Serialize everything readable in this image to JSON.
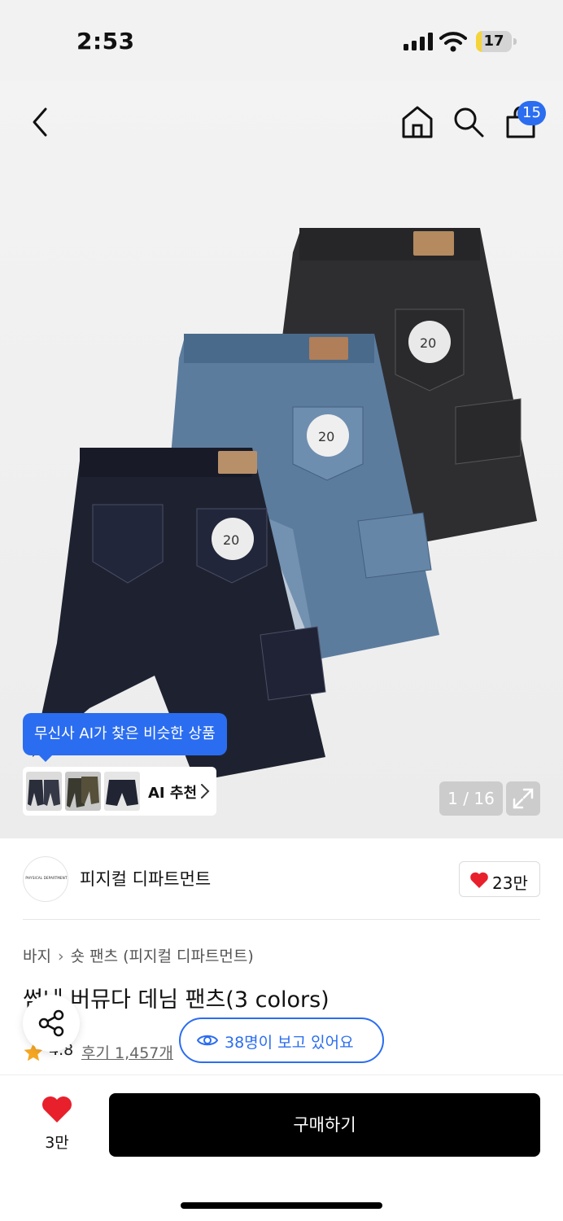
{
  "status_bar": {
    "time": "2:53",
    "battery": "17",
    "battery_fraction": 0.17
  },
  "header": {
    "back_icon": "chevron-left-icon",
    "home_icon": "home-icon",
    "search_icon": "search-icon",
    "cart_icon": "shopping-bag-icon",
    "cart_count": "15"
  },
  "gallery": {
    "ai_tooltip": "무신사 AI가 찾은 비슷한 상품",
    "ai_label": "AI 추천",
    "page_indicator": "1 / 16",
    "expand_icon": "expand-icon"
  },
  "brand": {
    "logo_text": "PHYSICAL DEPARTMENT",
    "name": "피지컬 디파트먼트",
    "like_count": "23만"
  },
  "breadcrumb": {
    "category": "바지",
    "subcategory": "숏 팬츠 (피지컬 디파트먼트)"
  },
  "product": {
    "title": "썸네 버뮤다 데님 팬츠(3 colors)",
    "rating": "4.8",
    "reviews": "후기 1,457개",
    "viewers": "38명이 보고 있어요"
  },
  "bottom_bar": {
    "wish_count": "3만",
    "buy_label": "구매하기"
  },
  "colors": {
    "accent": "#2b6df0",
    "heart": "#e8202c",
    "star": "#f5a623",
    "buy_button": "#000000"
  }
}
